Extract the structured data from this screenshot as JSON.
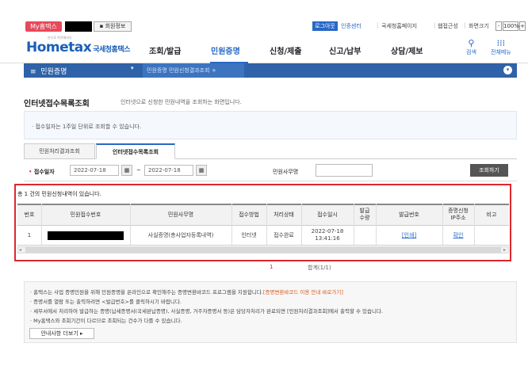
{
  "topbar": {
    "my_btn": "My홈택스",
    "member_btn": "회원정보",
    "login_btn": "로그아웃",
    "links": [
      "인증센터",
      "국세청홈페이지",
      "웹접근성",
      "화면크기"
    ],
    "zoom": "100%",
    "zoom_minus": "-",
    "zoom_plus": "+"
  },
  "gnb": {
    "logo": "Hometax",
    "logo_sub": "국세청홈택스",
    "logo_tag": "만으로 똑똑해지다",
    "menus": [
      "조회/발급",
      "민원증명",
      "신청/제출",
      "신고/납부",
      "상담/제보"
    ],
    "active_index": 1,
    "search_label": "검색",
    "allmenu_label": "전체메뉴"
  },
  "locbar": {
    "menu_label": "민원증명",
    "crumbs": "민원증명  민원신청결과조회"
  },
  "page": {
    "title": "인터넷접수목록조회",
    "desc": "인터넷으로 신청한 민원내역을 조회하는 화면입니다.",
    "info": "· 접수일자는 1주일 단위로 조회할 수 있습니다."
  },
  "tabs": [
    "민원처리결과조회",
    "인터넷접수목록조회"
  ],
  "active_tab": 1,
  "search": {
    "date_label": "접수일자",
    "date_from": "2022-07-18",
    "date_to": "2022-07-18",
    "tilde": "~",
    "work_label": "민원사무명",
    "work_value": "",
    "button": "조회하기"
  },
  "results": {
    "count_text": "총 1 건의 민원신청내역이 있습니다.",
    "columns": [
      "번호",
      "민원접수번호",
      "민원사무명",
      "접수방법",
      "처리상태",
      "접수일시",
      "발급\n수량",
      "발급번호",
      "증명신청\nIP주소",
      "비고"
    ],
    "rows": [
      {
        "no": "1",
        "receipt_no": "",
        "work": "사실증명(총사업자등록내역)",
        "method": "인터넷",
        "status": "접수완료",
        "datetime": "2022-07-18\n13:41:16",
        "qty": "",
        "issue_no": "[인쇄]",
        "ip": "확인",
        "note": ""
      }
    ]
  },
  "paging": {
    "current": "1",
    "total": "(1/1)"
  },
  "notes": {
    "line1_a": "· 홈택스는 사업 증명민원을 위해 민원증명을 온라인으로 확인해주는 증명변환바코드 프로그램을 지원합니다.",
    "line1_b": "[증명변환바코드 이용 안내 바로가기]",
    "line2": "· 증명서를 열람 또는 출력하려면 <발급번호>를 클릭하시기 바랍니다.",
    "line3": "· 세무서에서 처리하여 발급하는 증명(납세증명서(국세완납증명), 사실증명, 거주자증명서 등)은 담당자처리가 완료되면 [민원처리결과조회]에서 출력할 수 있습니다.",
    "line4": "· My홈택스와 조회기간이 다르므로 조회되는 건수가 다를 수 있습니다.",
    "more_btn": "안내사항 더보기 ▸"
  },
  "colors": {
    "brand_blue": "#2868c6",
    "loc_blue": "#2f62a8",
    "highlight_red": "#e1262e"
  }
}
